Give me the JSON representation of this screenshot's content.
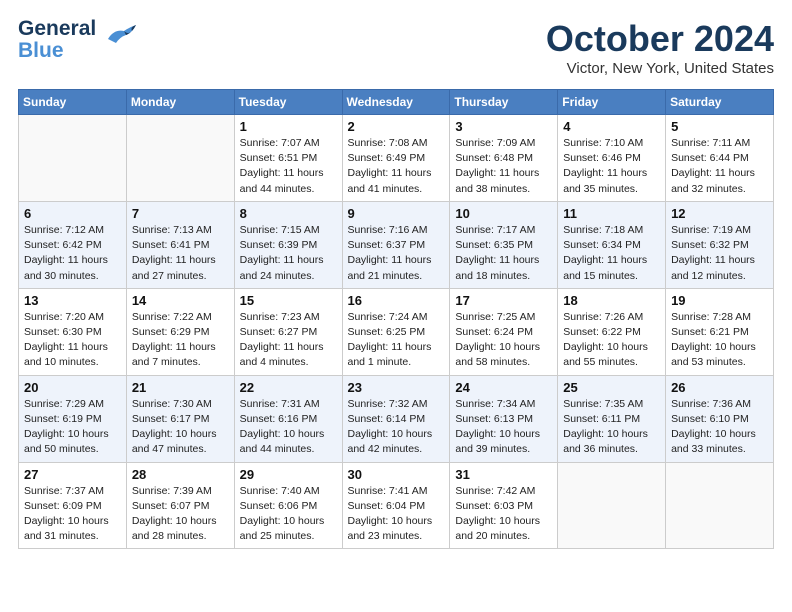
{
  "header": {
    "logo_line1": "General",
    "logo_line2": "Blue",
    "month": "October 2024",
    "location": "Victor, New York, United States"
  },
  "weekdays": [
    "Sunday",
    "Monday",
    "Tuesday",
    "Wednesday",
    "Thursday",
    "Friday",
    "Saturday"
  ],
  "weeks": [
    [
      {
        "day": "",
        "info": ""
      },
      {
        "day": "",
        "info": ""
      },
      {
        "day": "1",
        "info": "Sunrise: 7:07 AM\nSunset: 6:51 PM\nDaylight: 11 hours and 44 minutes."
      },
      {
        "day": "2",
        "info": "Sunrise: 7:08 AM\nSunset: 6:49 PM\nDaylight: 11 hours and 41 minutes."
      },
      {
        "day": "3",
        "info": "Sunrise: 7:09 AM\nSunset: 6:48 PM\nDaylight: 11 hours and 38 minutes."
      },
      {
        "day": "4",
        "info": "Sunrise: 7:10 AM\nSunset: 6:46 PM\nDaylight: 11 hours and 35 minutes."
      },
      {
        "day": "5",
        "info": "Sunrise: 7:11 AM\nSunset: 6:44 PM\nDaylight: 11 hours and 32 minutes."
      }
    ],
    [
      {
        "day": "6",
        "info": "Sunrise: 7:12 AM\nSunset: 6:42 PM\nDaylight: 11 hours and 30 minutes."
      },
      {
        "day": "7",
        "info": "Sunrise: 7:13 AM\nSunset: 6:41 PM\nDaylight: 11 hours and 27 minutes."
      },
      {
        "day": "8",
        "info": "Sunrise: 7:15 AM\nSunset: 6:39 PM\nDaylight: 11 hours and 24 minutes."
      },
      {
        "day": "9",
        "info": "Sunrise: 7:16 AM\nSunset: 6:37 PM\nDaylight: 11 hours and 21 minutes."
      },
      {
        "day": "10",
        "info": "Sunrise: 7:17 AM\nSunset: 6:35 PM\nDaylight: 11 hours and 18 minutes."
      },
      {
        "day": "11",
        "info": "Sunrise: 7:18 AM\nSunset: 6:34 PM\nDaylight: 11 hours and 15 minutes."
      },
      {
        "day": "12",
        "info": "Sunrise: 7:19 AM\nSunset: 6:32 PM\nDaylight: 11 hours and 12 minutes."
      }
    ],
    [
      {
        "day": "13",
        "info": "Sunrise: 7:20 AM\nSunset: 6:30 PM\nDaylight: 11 hours and 10 minutes."
      },
      {
        "day": "14",
        "info": "Sunrise: 7:22 AM\nSunset: 6:29 PM\nDaylight: 11 hours and 7 minutes."
      },
      {
        "day": "15",
        "info": "Sunrise: 7:23 AM\nSunset: 6:27 PM\nDaylight: 11 hours and 4 minutes."
      },
      {
        "day": "16",
        "info": "Sunrise: 7:24 AM\nSunset: 6:25 PM\nDaylight: 11 hours and 1 minute."
      },
      {
        "day": "17",
        "info": "Sunrise: 7:25 AM\nSunset: 6:24 PM\nDaylight: 10 hours and 58 minutes."
      },
      {
        "day": "18",
        "info": "Sunrise: 7:26 AM\nSunset: 6:22 PM\nDaylight: 10 hours and 55 minutes."
      },
      {
        "day": "19",
        "info": "Sunrise: 7:28 AM\nSunset: 6:21 PM\nDaylight: 10 hours and 53 minutes."
      }
    ],
    [
      {
        "day": "20",
        "info": "Sunrise: 7:29 AM\nSunset: 6:19 PM\nDaylight: 10 hours and 50 minutes."
      },
      {
        "day": "21",
        "info": "Sunrise: 7:30 AM\nSunset: 6:17 PM\nDaylight: 10 hours and 47 minutes."
      },
      {
        "day": "22",
        "info": "Sunrise: 7:31 AM\nSunset: 6:16 PM\nDaylight: 10 hours and 44 minutes."
      },
      {
        "day": "23",
        "info": "Sunrise: 7:32 AM\nSunset: 6:14 PM\nDaylight: 10 hours and 42 minutes."
      },
      {
        "day": "24",
        "info": "Sunrise: 7:34 AM\nSunset: 6:13 PM\nDaylight: 10 hours and 39 minutes."
      },
      {
        "day": "25",
        "info": "Sunrise: 7:35 AM\nSunset: 6:11 PM\nDaylight: 10 hours and 36 minutes."
      },
      {
        "day": "26",
        "info": "Sunrise: 7:36 AM\nSunset: 6:10 PM\nDaylight: 10 hours and 33 minutes."
      }
    ],
    [
      {
        "day": "27",
        "info": "Sunrise: 7:37 AM\nSunset: 6:09 PM\nDaylight: 10 hours and 31 minutes."
      },
      {
        "day": "28",
        "info": "Sunrise: 7:39 AM\nSunset: 6:07 PM\nDaylight: 10 hours and 28 minutes."
      },
      {
        "day": "29",
        "info": "Sunrise: 7:40 AM\nSunset: 6:06 PM\nDaylight: 10 hours and 25 minutes."
      },
      {
        "day": "30",
        "info": "Sunrise: 7:41 AM\nSunset: 6:04 PM\nDaylight: 10 hours and 23 minutes."
      },
      {
        "day": "31",
        "info": "Sunrise: 7:42 AM\nSunset: 6:03 PM\nDaylight: 10 hours and 20 minutes."
      },
      {
        "day": "",
        "info": ""
      },
      {
        "day": "",
        "info": ""
      }
    ]
  ]
}
